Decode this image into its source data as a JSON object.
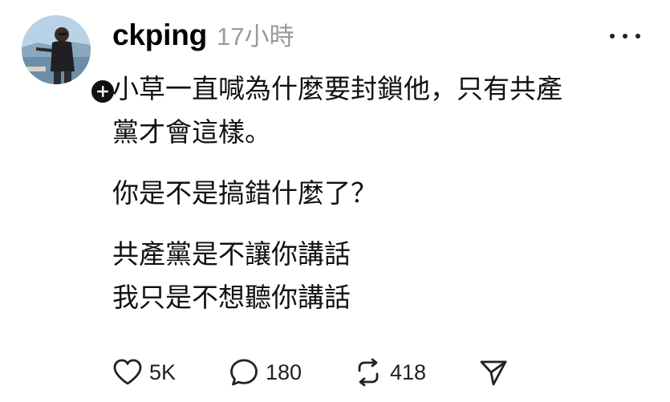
{
  "post": {
    "username": "ckping",
    "timestamp": "17小時",
    "paragraphs": [
      "小草一直喊為什麼要封鎖他，只有共產\n黨才會這樣。",
      "你是不是搞錯什麼了？",
      "共產黨是不讓你講話\n我只是不想聽你講話"
    ]
  },
  "actions": {
    "likes": "5K",
    "replies": "180",
    "reposts": "418"
  },
  "icons": {
    "follow": "plus-icon",
    "more": "more-dots-icon",
    "like": "heart-icon",
    "reply": "comment-bubble-icon",
    "repost": "repost-arrows-icon",
    "share": "send-icon"
  }
}
